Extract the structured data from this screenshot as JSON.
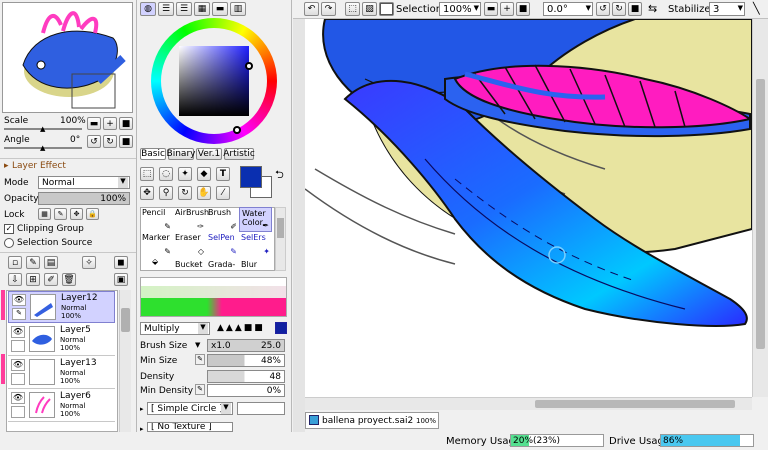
{
  "navigator": {
    "scale_label": "Scale",
    "scale_value": "100%",
    "angle_label": "Angle",
    "angle_value": "0°"
  },
  "layer_effect": {
    "title": "Layer Effect",
    "mode_label": "Mode",
    "mode_value": "Normal",
    "opacity_label": "Opacity",
    "opacity_value": "100%",
    "lock_label": "Lock",
    "clipping_group_label": "Clipping Group",
    "selection_source_label": "Selection Source"
  },
  "layers": [
    {
      "name": "Layer12",
      "mode": "Normal",
      "opacity": "100%",
      "selected": true
    },
    {
      "name": "Layer5",
      "mode": "Normal",
      "opacity": "100%",
      "selected": false
    },
    {
      "name": "Layer13",
      "mode": "Normal",
      "opacity": "100%",
      "selected": false
    },
    {
      "name": "Layer6",
      "mode": "Normal",
      "opacity": "100%",
      "selected": false
    }
  ],
  "color_tabs": [
    "Basic",
    "Binary",
    "Ver.1",
    "Artistic"
  ],
  "colors": {
    "primary": "#0a2fb0",
    "secondary": "#ffffff",
    "accent_sel": "#d2d2ff"
  },
  "tools": {
    "row1": [
      "Pencil",
      "AirBrush",
      "Brush",
      "Water Color"
    ],
    "row2": [
      "Marker",
      "Eraser",
      "SelPen",
      "SelErs"
    ],
    "row3": [
      "",
      "Bucket",
      "Grada-",
      "Blur"
    ]
  },
  "brush": {
    "blend_mode": "Multiply",
    "size_label": "Brush Size",
    "size_mult": "x1.0",
    "size_value": "25.0",
    "min_size_label": "Min Size",
    "min_size_value": "48%",
    "density_label": "Density",
    "density_value": "48",
    "min_density_label": "Min Density",
    "min_density_value": "0%",
    "shape": "[ Simple Circle ]",
    "texture": "[ No Texture ]"
  },
  "toolbar": {
    "selection_label": "Selection",
    "zoom_value": "100%",
    "rotation_value": "0.0°",
    "stabilizer_label": "Stabilizer",
    "stabilizer_value": "3"
  },
  "document_tab": {
    "name": "ballena proyect.sai2",
    "zoom": "100%"
  },
  "status": {
    "memory_label": "Memory Usage",
    "memory_value": "20%",
    "memory_paren": "(23%)",
    "memory_fraction": 0.2,
    "drive_label": "Drive Usage",
    "drive_value": "86%",
    "drive_fraction": 0.86
  }
}
